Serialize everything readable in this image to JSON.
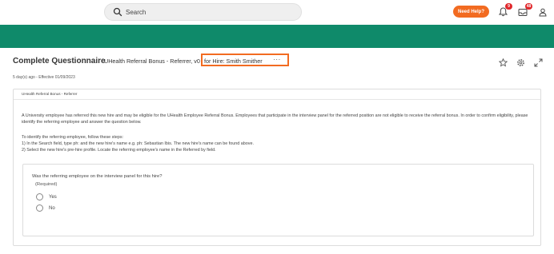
{
  "topbar": {
    "search_placeholder": "Search",
    "help_label": "Need Help?",
    "notifications_count": "9",
    "inbox_count": "48"
  },
  "colors": {
    "brand_band": "#0f8a6a",
    "accent": "#f26b21",
    "badge": "#e0272b"
  },
  "header": {
    "title": "Complete Questionnaire",
    "subtitle": "UHealth Referral Bonus - Referrer, v0",
    "subtitle_highlight": "for Hire: Smith Smither",
    "more_label": "···",
    "meta": "5 day(s) ago - Effective 01/09/2023"
  },
  "questionnaire": {
    "heading": "UHealth Referral Bonus - Referrer",
    "intro": "A University employee has referred this new hire and may be eligible for the UHealth Employee Referral Bonus. Employees that participate in the interview panel for the referred position are not eligible to receive the referral bonus. In order to confirm eligibility, please identify the referring employee and answer the question below.",
    "steps_title": "To identify the referring employee, follow these steps:",
    "step1": "1) In the Search field, type ph: and the new hire's name e.g. ph: Sebastian Ibis. The new hire's name can be found above.",
    "step2": "2) Select the new hire's pre-hire profile. Locate the referring employee's name in the Referred by field.",
    "question": "Was the referring employee on the interview panel for this hire?",
    "required": "(Required)",
    "options": [
      "Yes",
      "No"
    ]
  }
}
